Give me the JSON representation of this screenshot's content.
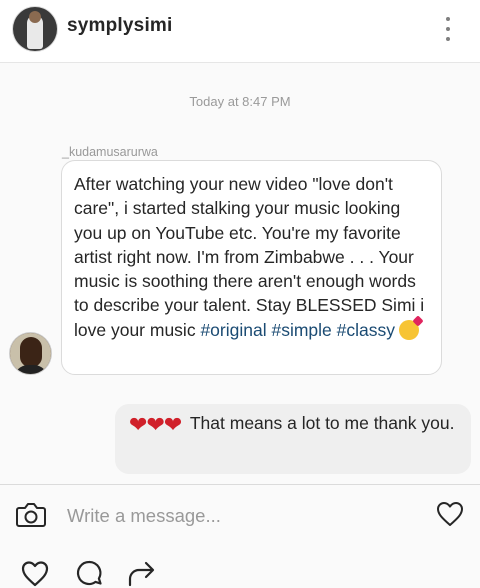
{
  "header": {
    "username": "symplysimi"
  },
  "conversation": {
    "timestamp": "Today at 8:47 PM",
    "incoming": {
      "sender": "_kudamusarurwa",
      "text": "After watching your new video \"love don't care\", i started stalking your music looking you up on YouTube etc. You're my favorite artist right now. I'm from Zimbabwe . . . Your music is soothing there aren't enough words to describe your talent. Stay BLESSED Simi i love your music",
      "hashtags": "#original #simple #classy",
      "emoji": "kissing-face-with-heart-emoji"
    },
    "outgoing": {
      "emoji": "three-red-hearts-emoji",
      "text": "That means a lot to me thank you."
    }
  },
  "composer": {
    "placeholder": "Write a message..."
  },
  "icons": {
    "menu": "kebab-menu-icon",
    "camera": "camera-icon",
    "send_heart": "heart-icon",
    "like": "heart-outline-icon",
    "comment": "comment-icon",
    "share": "share-icon"
  },
  "colors": {
    "hashtag": "#1b4b73",
    "heart_emoji": "#d0202a",
    "incoming_bubble": "#ffffff",
    "outgoing_bubble": "#efefef"
  }
}
